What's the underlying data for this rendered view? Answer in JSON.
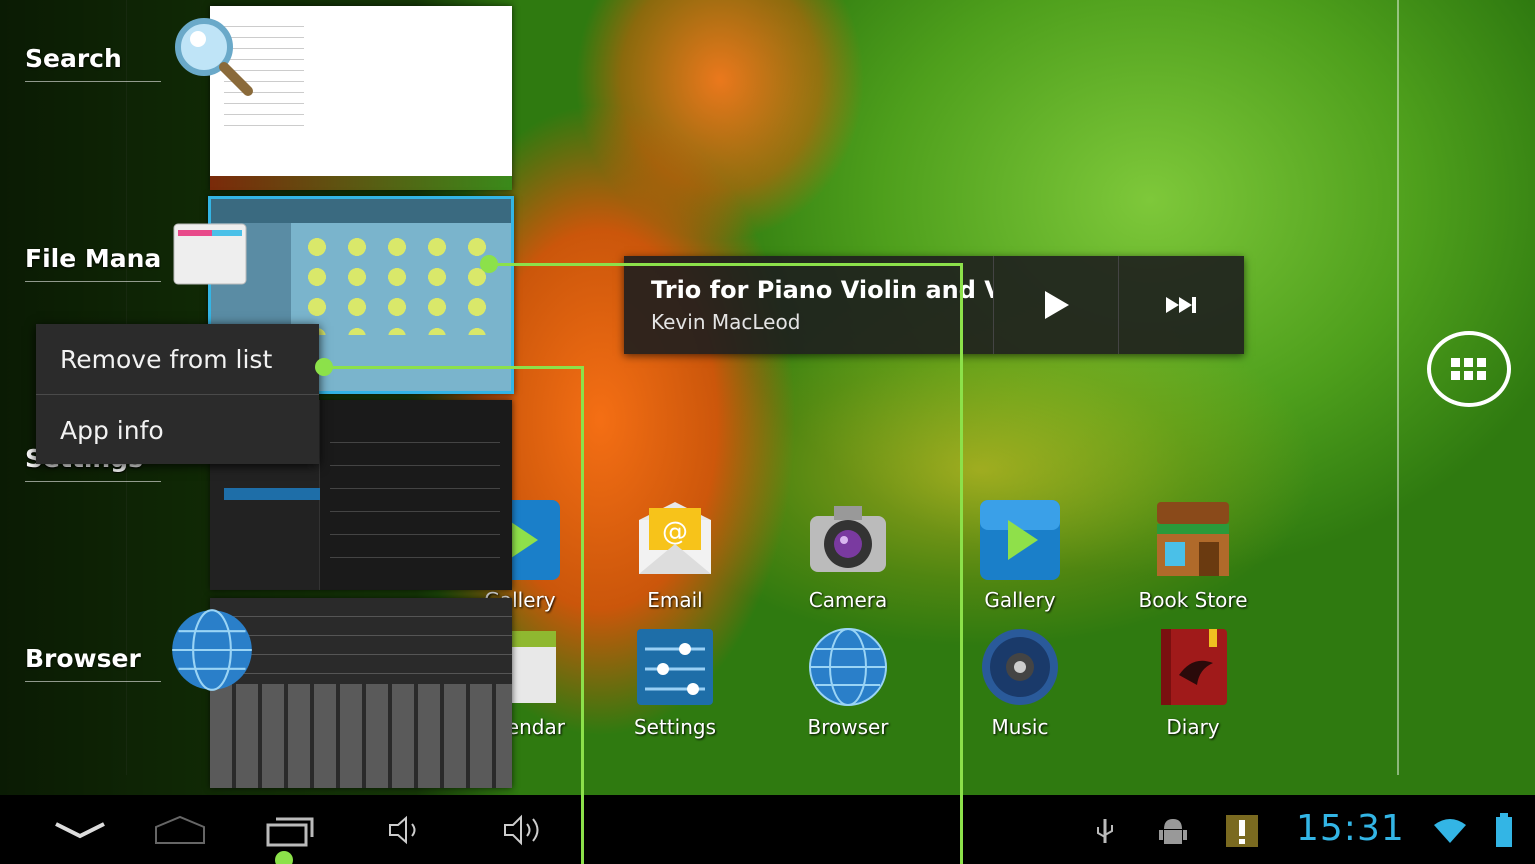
{
  "recents": {
    "items": [
      {
        "label": "Search"
      },
      {
        "label": "File Manager"
      },
      {
        "label": "Settings"
      },
      {
        "label": "Browser"
      }
    ]
  },
  "context_menu": {
    "items": [
      {
        "label": "Remove from list"
      },
      {
        "label": "App info"
      }
    ]
  },
  "music_widget": {
    "title": "Trio for Piano Violin and Viola",
    "artist": "Kevin MacLeod",
    "play_icon": "play-icon",
    "next_icon": "skip-next-icon"
  },
  "home": {
    "row1": [
      {
        "label": "Gallery",
        "icon": "gallery-icon"
      },
      {
        "label": "Email",
        "icon": "email-icon"
      },
      {
        "label": "Camera",
        "icon": "camera-icon"
      },
      {
        "label": "Gallery",
        "icon": "gallery-icon"
      },
      {
        "label": "Book Store",
        "icon": "book-store-icon"
      }
    ],
    "row2": [
      {
        "label": "Calendar",
        "icon": "calendar-icon"
      },
      {
        "label": "Settings",
        "icon": "settings-icon"
      },
      {
        "label": "Browser",
        "icon": "browser-icon"
      },
      {
        "label": "Music",
        "icon": "music-icon"
      },
      {
        "label": "Diary",
        "icon": "diary-icon"
      }
    ],
    "background_label": "File Manager"
  },
  "status_bar": {
    "time": "15:31"
  },
  "colors": {
    "accent": "#33b5e5",
    "callout": "#8ce14a"
  }
}
